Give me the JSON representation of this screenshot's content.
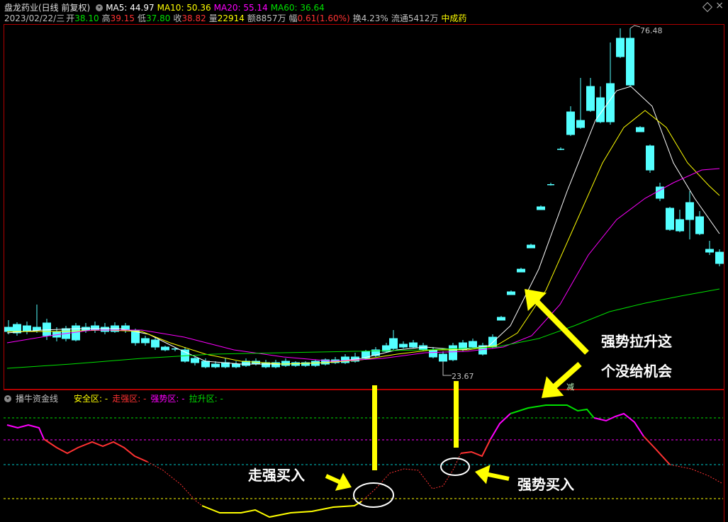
{
  "header": {
    "title": "盘龙药业(日线 前复权)",
    "ma5": "MA5: 44.97",
    "ma10": "MA10: 50.36",
    "ma20": "MA20: 55.14",
    "ma60": "MA60: 36.64",
    "date": "2023/02/22/三",
    "open_label": "开",
    "open": "38.10",
    "high_label": "高",
    "high": "39.15",
    "low_label": "低",
    "low": "37.80",
    "close_label": "收",
    "close": "38.82",
    "vol_label": "量",
    "vol": "22914",
    "amt_label": "额",
    "amt": "8857万",
    "chg_label": "幅",
    "chg": "0.61(1.60%)",
    "turnover": "换4.23%",
    "float": "流通5412万",
    "industry": "中成药"
  },
  "colors": {
    "ma5": "#ffffff",
    "ma10": "#ffff00",
    "ma20": "#ff00ff",
    "ma60": "#00e000",
    "up": "#ff3232",
    "down": "#54ffff",
    "border": "#b00000"
  },
  "price_labels": {
    "high": "76.48",
    "low": "23.67"
  },
  "indicator": {
    "name": "播牛资金线",
    "safe": "安全区: -",
    "strong": "走强区: -",
    "trend": "强势区: -",
    "rise": "拉升区: -",
    "tag": "减"
  },
  "annotations": {
    "callout_main_line1": "强势拉升这",
    "callout_main_line2": "个没给机会",
    "buy1": "走强买入",
    "buy2": "强势买入"
  }
}
